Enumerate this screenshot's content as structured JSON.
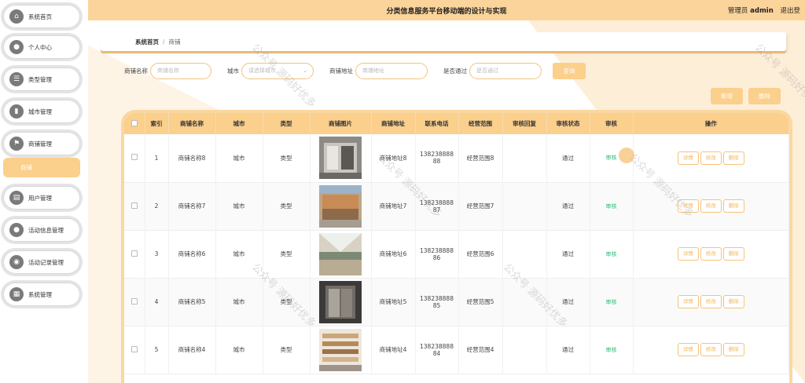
{
  "app": {
    "title": "分类信息服务平台移动端的设计与实现",
    "user_role": "管理员",
    "username": "admin",
    "logout": "退出登"
  },
  "sidebar": {
    "items": [
      {
        "label": "系统首页",
        "icon": "home-icon"
      },
      {
        "label": "个人中心",
        "icon": "user-icon"
      },
      {
        "label": "类型管理",
        "icon": "list-icon"
      },
      {
        "label": "城市管理",
        "icon": "building-icon"
      },
      {
        "label": "商铺管理",
        "icon": "flag-icon"
      },
      {
        "label": "用户管理",
        "icon": "users-icon"
      },
      {
        "label": "活动信息管理",
        "icon": "user-circle-icon"
      },
      {
        "label": "活动记录管理",
        "icon": "record-icon"
      },
      {
        "label": "系统管理",
        "icon": "grid-icon"
      }
    ],
    "active_sub": "商铺"
  },
  "breadcrumb": {
    "home": "系统首页",
    "sep": "/",
    "current": "商铺"
  },
  "search": {
    "name_label": "商铺名称",
    "name_placeholder": "商铺名称",
    "city_label": "城市",
    "city_placeholder": "请选择城市",
    "addr_label": "商铺地址",
    "addr_placeholder": "商铺地址",
    "pass_label": "是否通过",
    "pass_placeholder": "是否通过",
    "query": "查询"
  },
  "actions": {
    "add": "新增",
    "delete": "删除"
  },
  "table": {
    "headers": [
      "",
      "索引",
      "商铺名称",
      "城市",
      "类型",
      "商铺图片",
      "商铺地址",
      "联系电话",
      "经营范围",
      "审核回复",
      "审核状态",
      "审核",
      "操作"
    ],
    "rows": [
      {
        "index": "1",
        "name": "商铺名称8",
        "city": "城市",
        "type": "类型",
        "addr": "商铺地址8",
        "phone1": "138238888",
        "phone2": "88",
        "scope": "经营范围8",
        "reply": "",
        "status": "通过",
        "audit": "审核"
      },
      {
        "index": "2",
        "name": "商铺名称7",
        "city": "城市",
        "type": "类型",
        "addr": "商铺地址7",
        "phone1": "138238888",
        "phone2": "87",
        "scope": "经营范围7",
        "reply": "",
        "status": "通过",
        "audit": "审核"
      },
      {
        "index": "3",
        "name": "商铺名称6",
        "city": "城市",
        "type": "类型",
        "addr": "商铺地址6",
        "phone1": "138238888",
        "phone2": "86",
        "scope": "经营范围6",
        "reply": "",
        "status": "通过",
        "audit": "审核"
      },
      {
        "index": "4",
        "name": "商铺名称5",
        "city": "城市",
        "type": "类型",
        "addr": "商铺地址5",
        "phone1": "138238888",
        "phone2": "85",
        "scope": "经营范围5",
        "reply": "",
        "status": "通过",
        "audit": "审核"
      },
      {
        "index": "5",
        "name": "商铺名称4",
        "city": "城市",
        "type": "类型",
        "addr": "商铺地址4",
        "phone1": "138238888",
        "phone2": "84",
        "scope": "经营范围4",
        "reply": "",
        "status": "通过",
        "audit": "审核"
      }
    ],
    "ops": {
      "detail": "详情",
      "edit": "修改",
      "del": "删除"
    }
  },
  "watermark": "公众号 源码好优多",
  "colors": {
    "accent": "#fbcf8c",
    "topbar": "#fbd49b",
    "audit": "#2dbb7a"
  }
}
